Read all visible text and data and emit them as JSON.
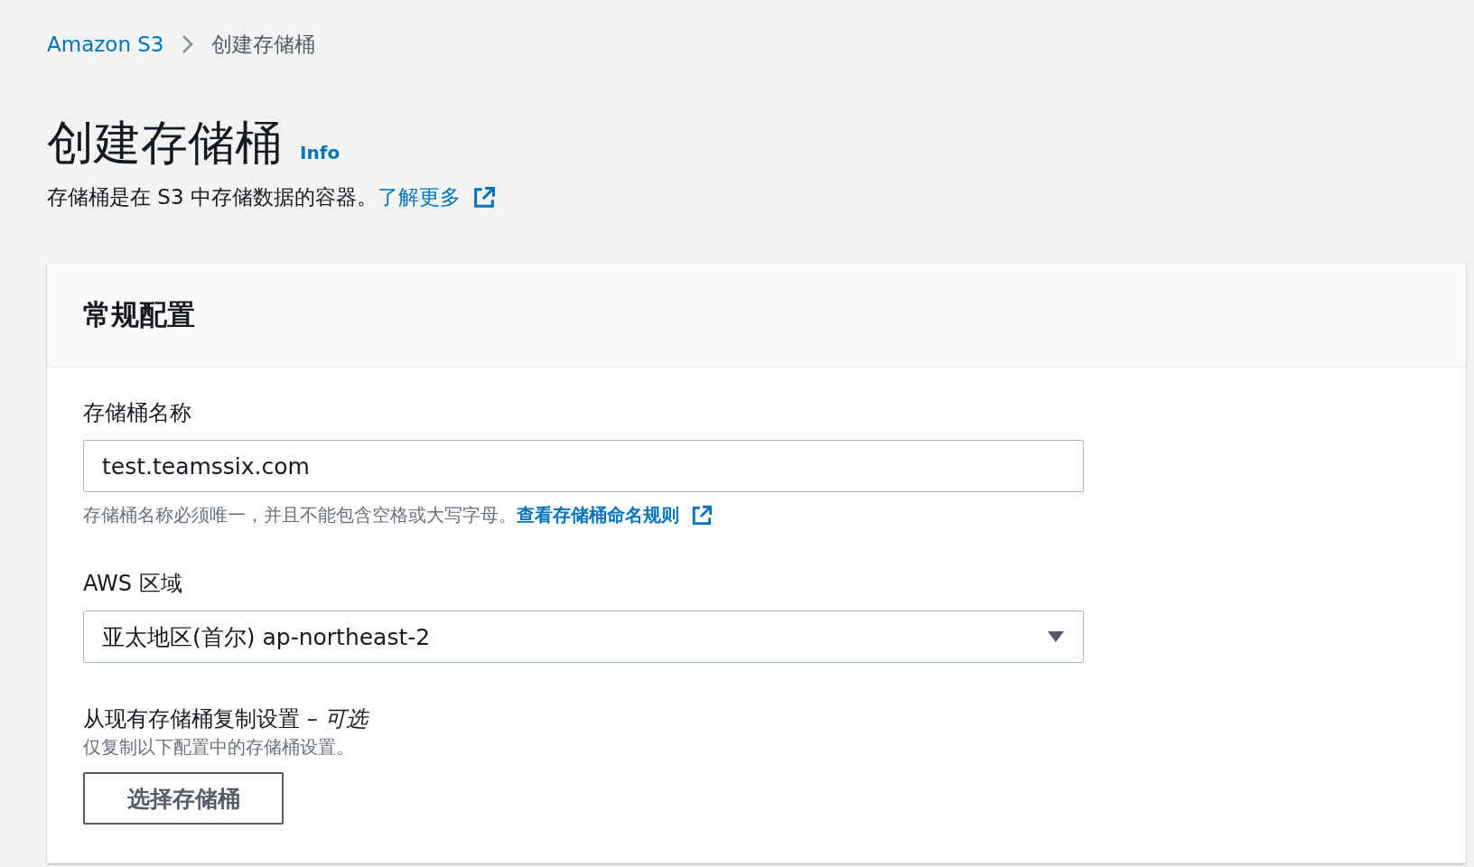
{
  "breadcrumb": [
    {
      "label": "Amazon S3",
      "kind": "link"
    },
    {
      "label": "创建存储桶",
      "kind": "current"
    }
  ],
  "header": {
    "title": "创建存储桶",
    "info": "Info",
    "description": "存储桶是在 S3 中存储数据的容器。",
    "learn_more": "了解更多"
  },
  "panel": {
    "title": "常规配置",
    "fields": [
      {
        "kind": "text",
        "label": "存储桶名称",
        "value": "test.teamssix.com",
        "hint": "存储桶名称必须唯一，并且不能包含空格或大写字母。",
        "hint_link": "查看存储桶命名规则"
      },
      {
        "kind": "select",
        "label": "AWS 区域",
        "value": "亚太地区(首尔) ap-northeast-2"
      },
      {
        "kind": "button",
        "label": "从现有存储桶复制设置 – *可选*",
        "hint": "仅复制以下配置中的存储桶设置。",
        "button": "选择存储桶"
      }
    ]
  }
}
